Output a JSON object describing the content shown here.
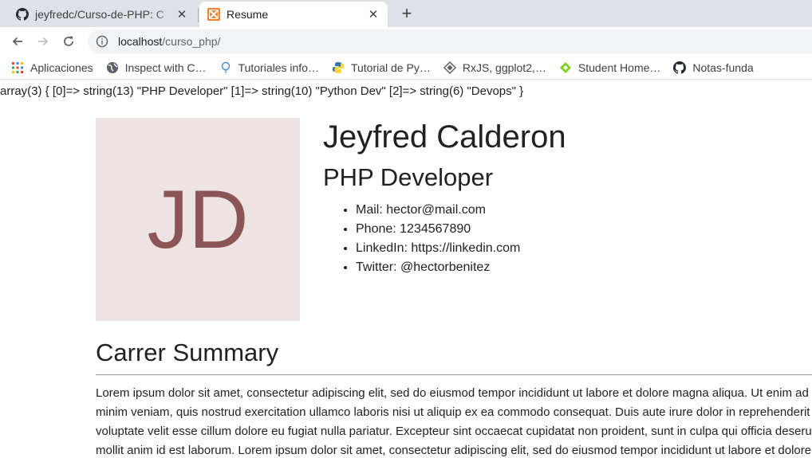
{
  "browser": {
    "tabs": [
      {
        "title": "jeyfredc/Curso-de-PHP: C",
        "icon": "github-icon",
        "active": false
      },
      {
        "title": "Resume",
        "icon": "xampp-icon",
        "active": true
      }
    ],
    "address": {
      "host": "localhost",
      "path": "/curso_php/"
    },
    "bookmarks": [
      {
        "label": "Aplicaciones",
        "icon": "apps-grid-icon"
      },
      {
        "label": "Inspect with C…",
        "icon": "globe-icon"
      },
      {
        "label": "Tutoriales info…",
        "icon": "bulb-icon"
      },
      {
        "label": "Tutorial de Py…",
        "icon": "python-icon"
      },
      {
        "label": "RxJS, ggplot2,…",
        "icon": "diamond-icon"
      },
      {
        "label": "Student Home…",
        "icon": "diamond-green-icon"
      },
      {
        "label": "Notas-funda",
        "icon": "github-icon"
      }
    ]
  },
  "page": {
    "var_dump": "array(3) { [0]=> string(13) \"PHP Developer\" [1]=> string(10) \"Python Dev\" [2]=> string(6) \"Devops\" }",
    "photo_initials": "JD",
    "name": "Jeyfred Calderon",
    "role": "PHP Developer",
    "contacts": [
      "Mail: hector@mail.com",
      "Phone: 1234567890",
      "LinkedIn: https://linkedin.com",
      "Twitter: @hectorbenitez"
    ],
    "summary_title": "Carrer Summary",
    "summary_text": "Lorem ipsum dolor sit amet, consectetur adipiscing elit, sed do eiusmod tempor incididunt ut labore et dolore magna aliqua. Ut enim ad minim veniam, quis nostrud exercitation ullamco laboris nisi ut aliquip ex ea commodo consequat. Duis aute irure dolor in reprehenderit in voluptate velit esse cillum dolore eu fugiat nulla pariatur. Excepteur sint occaecat cupidatat non proident, sunt in culpa qui officia deserunt mollit anim id est laborum. Lorem ipsum dolor sit amet, consectetur adipiscing elit, sed do eiusmod tempor incididunt ut labore et dolore magna aliqua. Ut enim ad minim veniam, quis nostrud"
  },
  "colors": {
    "tabstrip": "#dee1e6",
    "photo_bg": "#ede3e3",
    "initials": "#8c5555"
  }
}
